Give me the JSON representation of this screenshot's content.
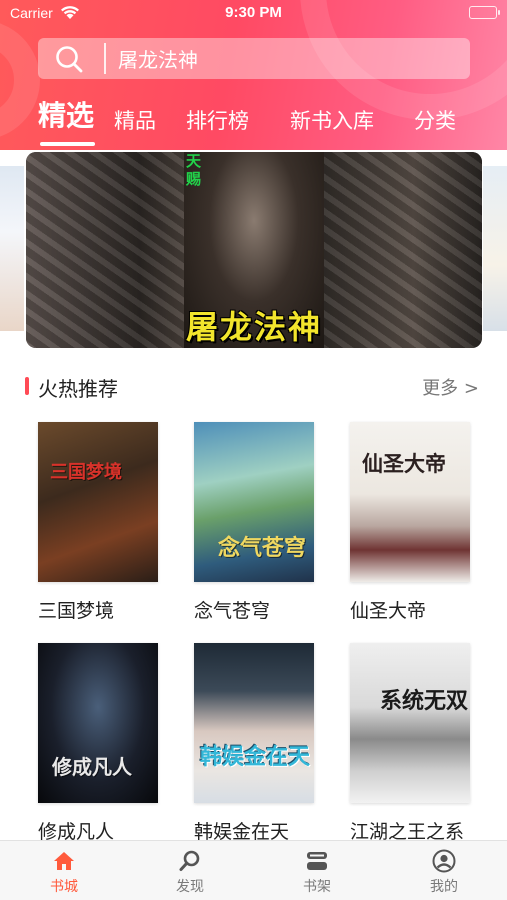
{
  "status_bar": {
    "carrier": "Carrier",
    "time": "9:30 PM"
  },
  "search": {
    "value": "屠龙法神"
  },
  "tabs": [
    {
      "label": "精选",
      "active": true
    },
    {
      "label": "精品",
      "active": false
    },
    {
      "label": "排行榜",
      "active": false
    },
    {
      "label": "新书入库",
      "active": false
    },
    {
      "label": "分类",
      "active": false
    }
  ],
  "banner": {
    "title": "屠龙法神",
    "tag": "天赐"
  },
  "section": {
    "title": "火热推荐",
    "more": "更多 >"
  },
  "books": [
    {
      "title": "三国梦境",
      "cover_text": "三国梦境"
    },
    {
      "title": "念气苍穹",
      "cover_text": "念气苍穹"
    },
    {
      "title": "仙圣大帝",
      "cover_text": "仙圣大帝"
    },
    {
      "title": "修成凡人",
      "cover_text": "修成凡人"
    },
    {
      "title": "韩娱金在天",
      "cover_text": "韩娱金在天"
    },
    {
      "title": "江湖之王之系统无双",
      "cover_text": "系统无双"
    }
  ],
  "tabbar": [
    {
      "label": "书城",
      "icon": "home-icon",
      "active": true
    },
    {
      "label": "发现",
      "icon": "search-icon",
      "active": false
    },
    {
      "label": "书架",
      "icon": "bookshelf-icon",
      "active": false
    },
    {
      "label": "我的",
      "icon": "profile-icon",
      "active": false
    }
  ],
  "colors": {
    "header_start": "#ff5a5a",
    "header_end": "#ff86a6",
    "accent": "#ff5a3c",
    "cover_title_yellow": "#f2e52c"
  }
}
